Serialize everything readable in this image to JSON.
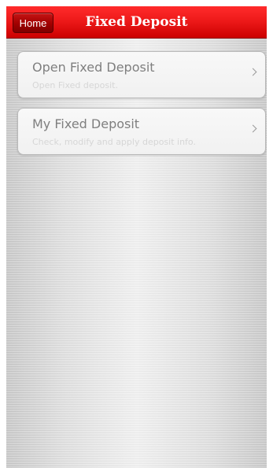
{
  "header": {
    "home_label": "Home",
    "title": "Fixed Deposit"
  },
  "menu": {
    "items": [
      {
        "title": "Open Fixed Deposit",
        "subtitle": "Open Fixed deposit.",
        "icon": "chevron-right-icon"
      },
      {
        "title": "My Fixed Deposit",
        "subtitle": "Check, modify and apply deposit info.",
        "icon": "chevron-right-icon"
      }
    ]
  },
  "colors": {
    "header_red": "#ee1a1a",
    "home_button": "#a10000",
    "background_silver": "#dedede"
  }
}
